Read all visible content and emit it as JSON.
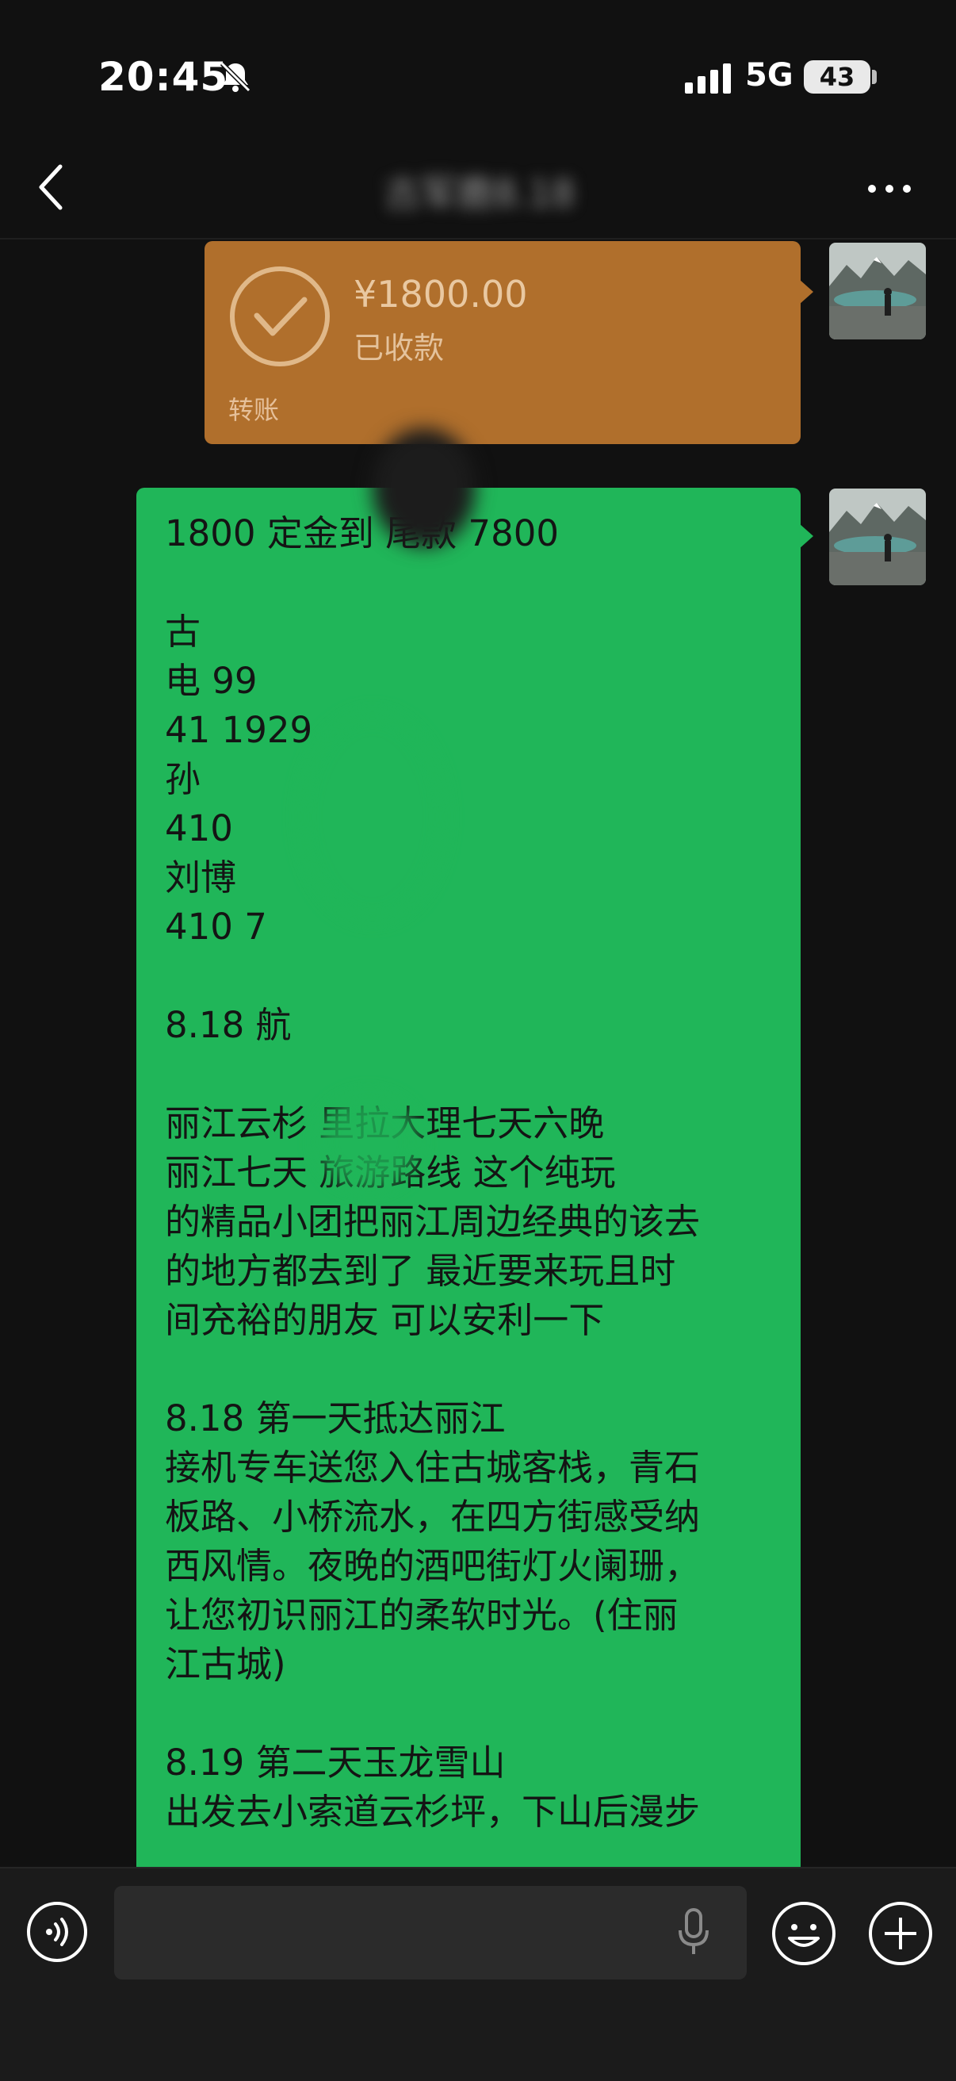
{
  "status_bar": {
    "time": "20:45",
    "network": "5G",
    "battery": "43"
  },
  "nav": {
    "title": "古军鹿8.18"
  },
  "transfer": {
    "amount": "¥1800.00",
    "status": "已收款",
    "label": "转账"
  },
  "message": {
    "text": "1800 定金到 尾款 7800\n\n古 \n电 99\n41 1929\n孙 \n410 \n刘博 \n410 7\n\n8.18 航 \n\n丽江云杉 里拉大理七天六晚\n丽江七天 旅游路线 这个纯玩\n的精品小团把丽江周边经典的该去\n的地方都去到了 最近要来玩且时\n间充裕的朋友 可以安利一下\n\n8.18 第一天抵达丽江\n接机专车送您入住古城客栈，青石\n板路、小桥流水，在四方街感受纳\n西风情。夜晚的酒吧街灯火阑珊，\n让您初识丽江的柔软时光。(住丽\n江古城)\n\n8.19 第二天玉龙雪山\n出发去小索道云杉坪，下山后漫步"
  },
  "colors": {
    "transfer_bg": "#b06f2c",
    "message_bg": "#20b659",
    "background": "#111111"
  },
  "icons": [
    "back-arrow-icon",
    "more-icon",
    "bell-mute-icon",
    "signal-icon",
    "check-circle-icon",
    "voice-icon",
    "mic-icon",
    "emoji-icon",
    "plus-icon"
  ]
}
